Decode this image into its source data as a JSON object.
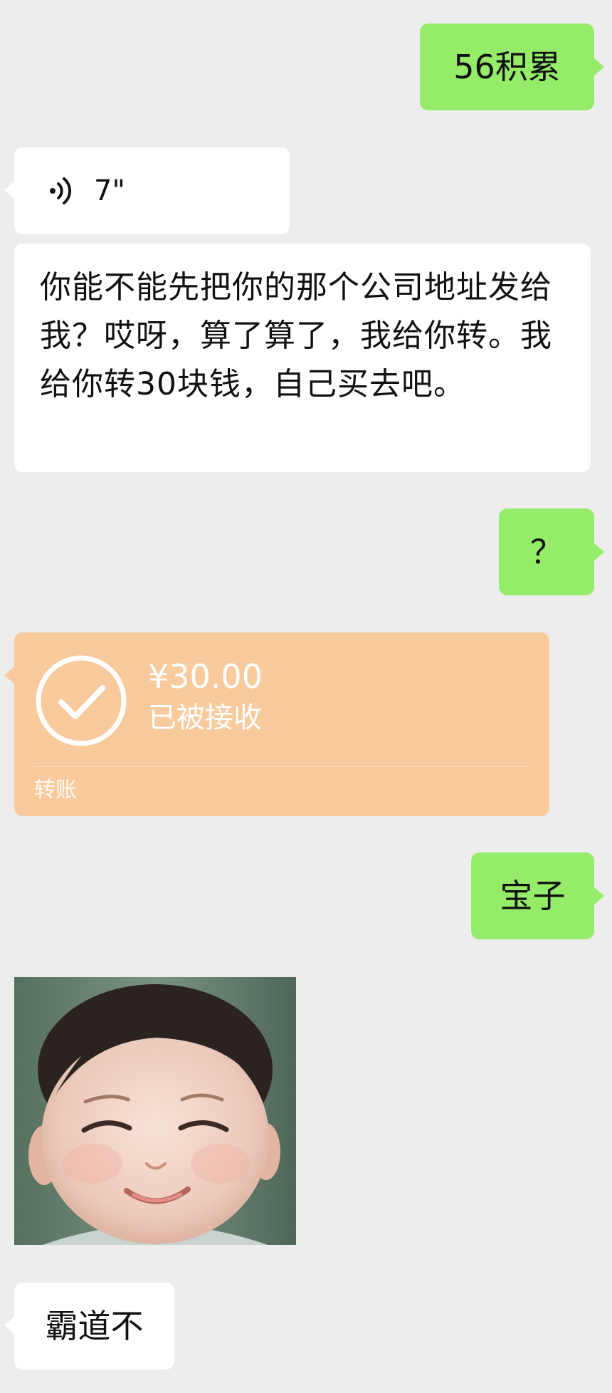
{
  "messages": {
    "m1": {
      "direction": "out",
      "text": "56积累"
    },
    "m2": {
      "direction": "in",
      "type": "voice",
      "duration": "7\"",
      "icon": "voice-wave-icon"
    },
    "m3": {
      "direction": "in",
      "text": "你能不能先把你的那个公司地址发给我？哎呀，算了算了，我给你转。我给你转30块钱，自己买去吧。"
    },
    "m4": {
      "direction": "out",
      "text": "？"
    },
    "m5": {
      "direction": "in",
      "type": "transfer",
      "amount": "¥30.00",
      "status": "已被接收",
      "label": "转账",
      "icon": "check-circle-icon"
    },
    "m6": {
      "direction": "out",
      "text": "宝子"
    },
    "m7": {
      "direction": "in",
      "type": "sticker",
      "description_icon": "smiling-baby-sticker"
    },
    "m8": {
      "direction": "in",
      "text": "霸道不"
    }
  },
  "colors": {
    "background": "#ededed",
    "outgoing_bubble": "#95ec69",
    "incoming_bubble": "#ffffff",
    "transfer_card": "#f9cb9c"
  }
}
